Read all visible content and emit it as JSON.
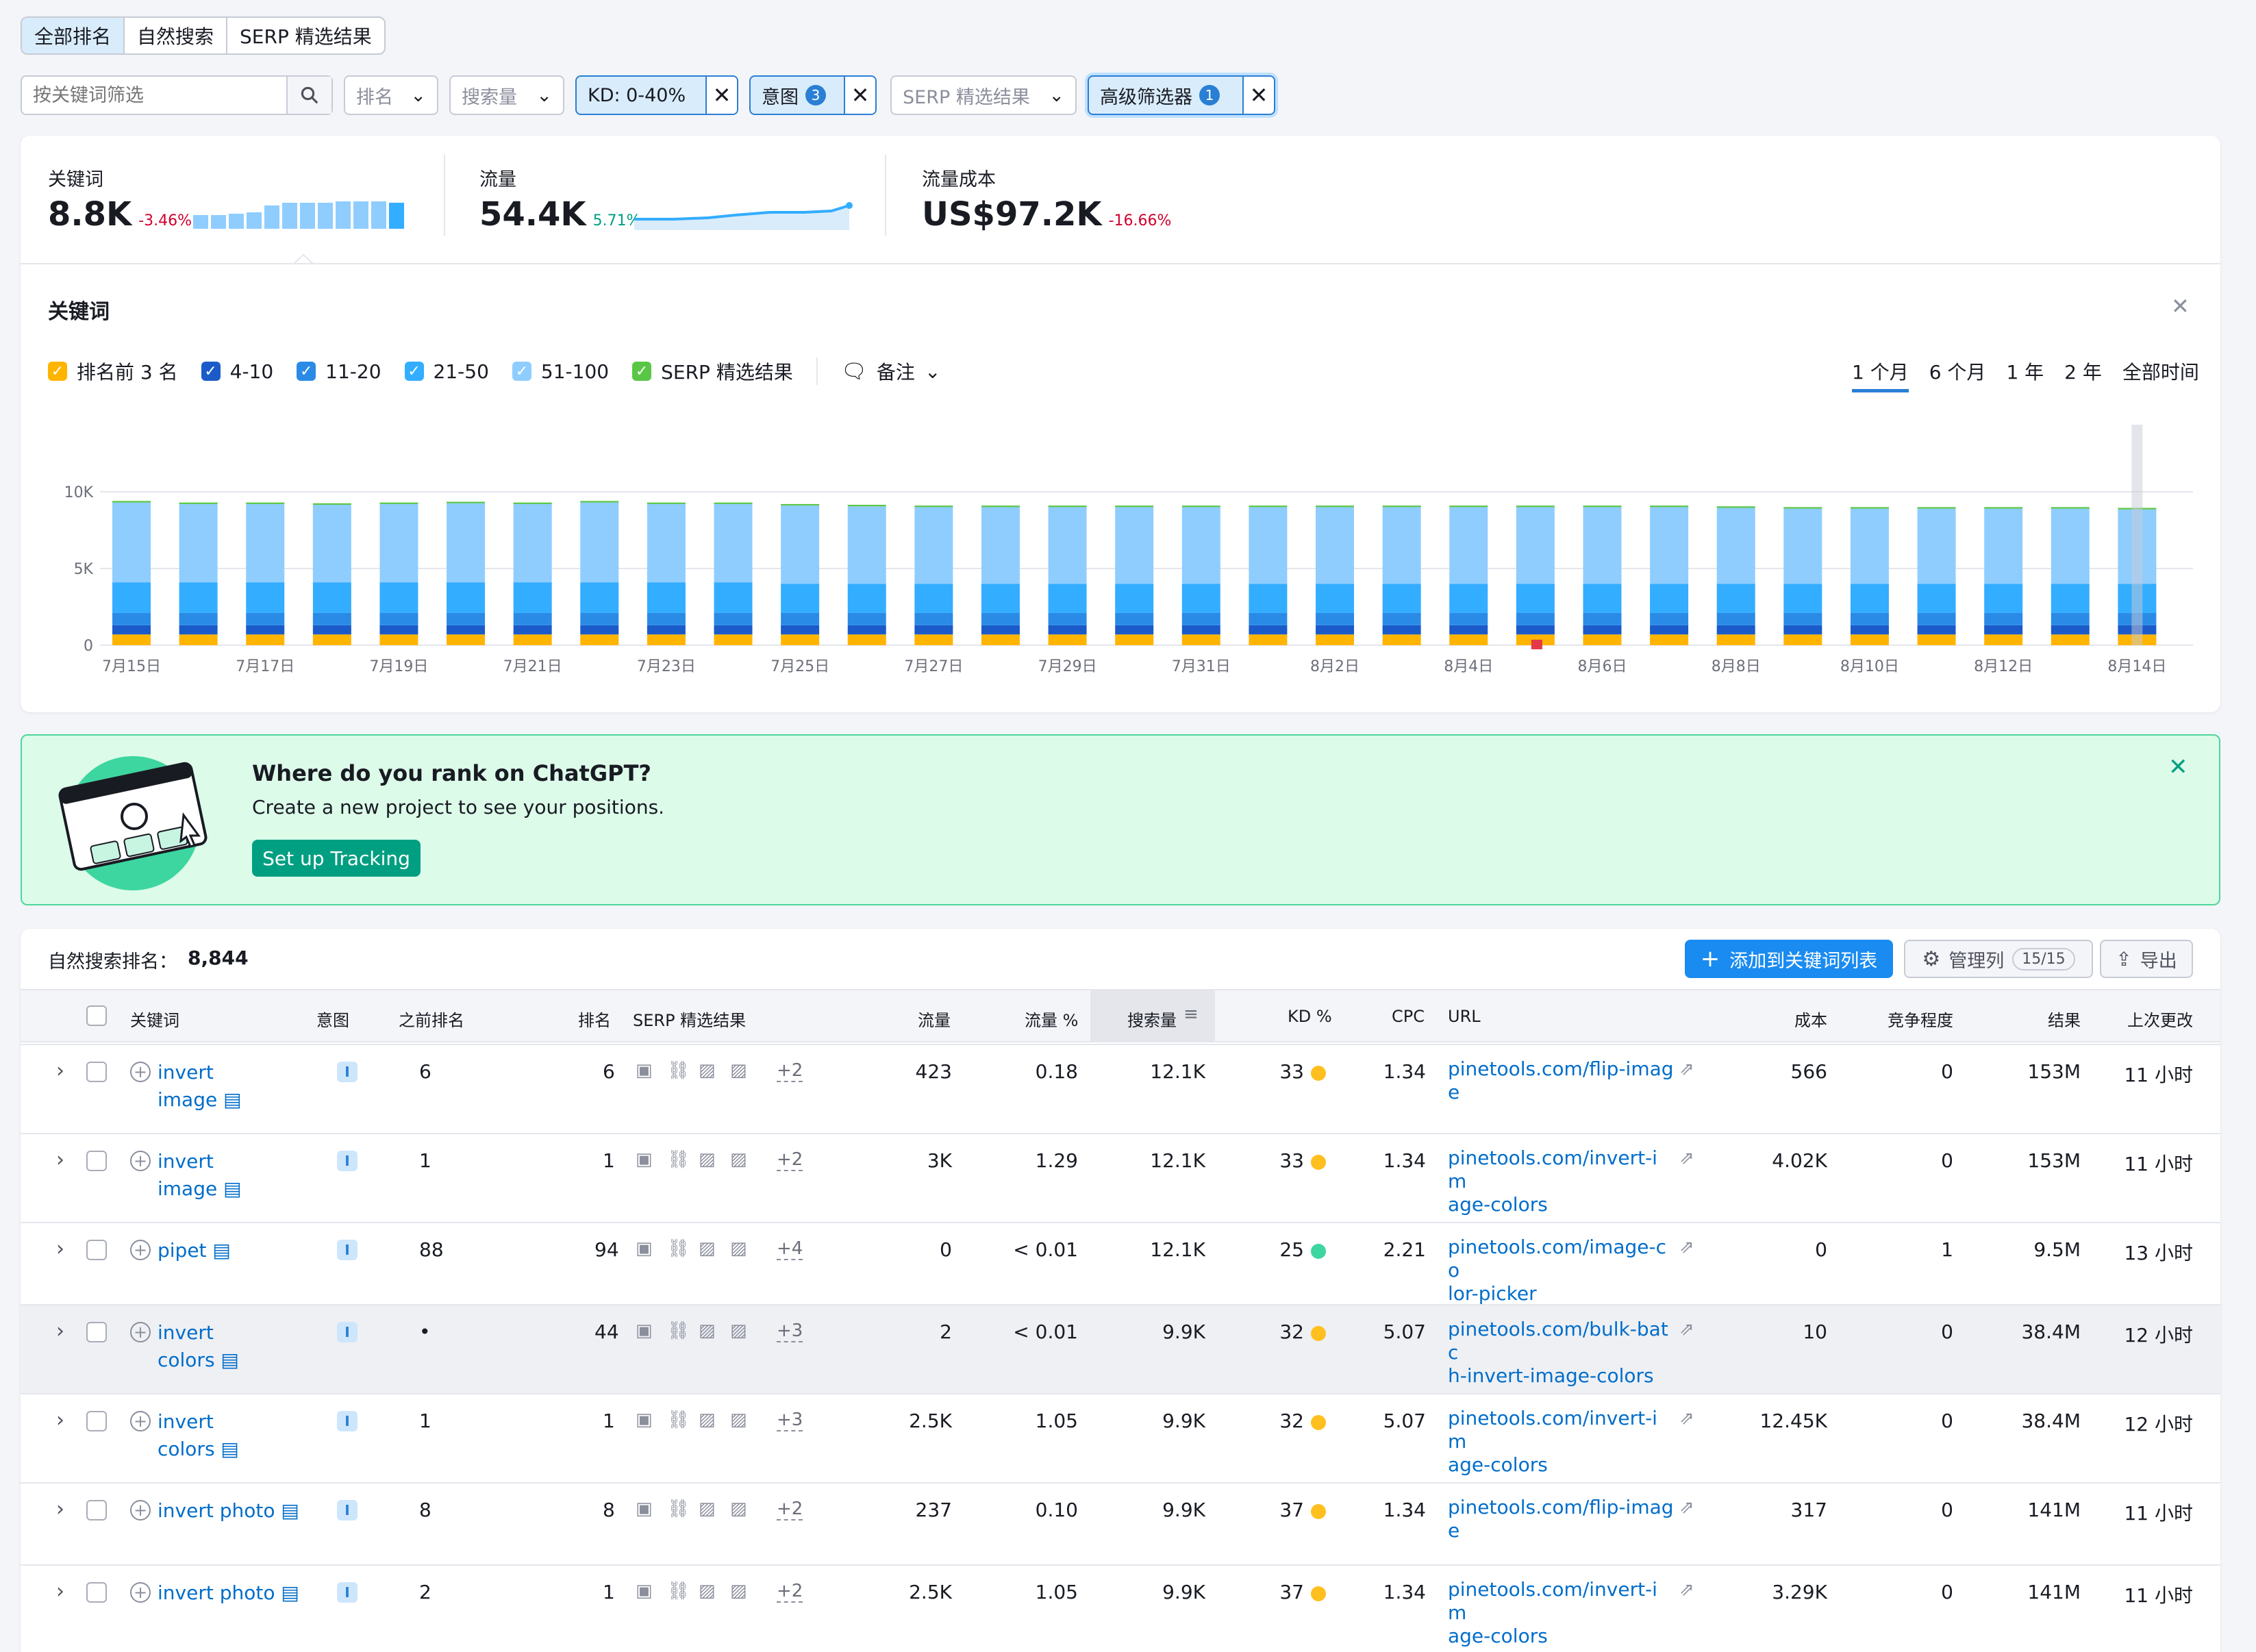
{
  "tabs": [
    "全部排名",
    "自然搜索",
    "SERP 精选结果"
  ],
  "filters": {
    "keyword_placeholder": "按关键词筛选",
    "rank": "排名",
    "volume": "搜索量",
    "kd_chip": "KD: 0-40%",
    "intent_chip": "意图",
    "intent_count": "3",
    "serp": "SERP 精选结果",
    "advanced_chip": "高级筛选器",
    "advanced_count": "1"
  },
  "kpis": [
    {
      "label": "关键词",
      "value": "8.8K",
      "change": "-3.46%"
    },
    {
      "label": "流量",
      "value": "54.4K",
      "change": "5.71%"
    },
    {
      "label": "流量成本",
      "value": "US$97.2K",
      "change": "-16.66%"
    }
  ],
  "chart_panel": {
    "title": "关键词",
    "legend": [
      "排名前 3 名",
      "4-10",
      "11-20",
      "21-50",
      "51-100",
      "SERP 精选结果"
    ],
    "notes": "备注",
    "periods": [
      "1 个月",
      "6 个月",
      "1 年",
      "2 年",
      "全部时间"
    ],
    "active_period": "1 个月"
  },
  "chart_data": {
    "type": "bar",
    "stacked": true,
    "ylim": [
      0,
      10000
    ],
    "yticks": [
      "10K",
      "5K",
      "0"
    ],
    "xticks": [
      "7月15日",
      "7月17日",
      "7月19日",
      "7月21日",
      "7月23日",
      "7月25日",
      "7月27日",
      "7月29日",
      "7月31日",
      "8月2日",
      "8月4日",
      "8月6日",
      "8月8日",
      "8月10日",
      "8月12日",
      "8月14日"
    ],
    "series": [
      {
        "name": "排名前 3 名",
        "color": "#ffb400",
        "values": [
          700,
          700,
          700,
          700,
          700,
          700,
          700,
          700,
          700,
          700,
          700,
          700,
          700,
          700,
          700,
          700,
          700,
          700,
          700,
          700,
          700,
          700,
          700,
          700,
          700,
          700,
          700,
          700,
          700,
          700,
          700
        ]
      },
      {
        "name": "4-10",
        "color": "#1a5bc9",
        "values": [
          600,
          600,
          600,
          600,
          600,
          600,
          600,
          600,
          600,
          600,
          600,
          600,
          600,
          600,
          600,
          600,
          600,
          600,
          600,
          600,
          600,
          600,
          600,
          600,
          600,
          600,
          600,
          600,
          600,
          600,
          600
        ]
      },
      {
        "name": "11-20",
        "color": "#2a8be6",
        "values": [
          800,
          800,
          800,
          800,
          800,
          800,
          800,
          800,
          800,
          800,
          800,
          800,
          800,
          800,
          800,
          800,
          800,
          800,
          800,
          800,
          800,
          800,
          800,
          800,
          800,
          800,
          800,
          800,
          800,
          800,
          800
        ]
      },
      {
        "name": "21-50",
        "color": "#33adff",
        "values": [
          2000,
          2000,
          2000,
          2000,
          2000,
          2000,
          2000,
          2000,
          2000,
          2000,
          1900,
          1900,
          1900,
          1900,
          1900,
          1900,
          1900,
          1900,
          1900,
          1900,
          1900,
          1900,
          1900,
          1900,
          1900,
          1900,
          1900,
          1900,
          1900,
          1900,
          1900
        ]
      },
      {
        "name": "51-100",
        "color": "#8fcdff",
        "values": [
          5200,
          5100,
          5100,
          5050,
          5100,
          5150,
          5100,
          5200,
          5100,
          5100,
          5100,
          5050,
          5000,
          5000,
          5000,
          5000,
          5000,
          5000,
          5000,
          5000,
          5000,
          5000,
          5000,
          5000,
          4950,
          4900,
          4900,
          4900,
          4900,
          4900,
          4850
        ]
      },
      {
        "name": "SERP 精选结果",
        "color": "#59c646",
        "values": [
          100,
          100,
          100,
          100,
          100,
          100,
          100,
          100,
          100,
          100,
          100,
          100,
          100,
          100,
          100,
          100,
          100,
          100,
          100,
          100,
          100,
          100,
          100,
          100,
          100,
          100,
          100,
          100,
          100,
          100,
          100
        ]
      }
    ]
  },
  "banner": {
    "title": "Where do you rank on ChatGPT?",
    "text": "Create a new project to see your positions.",
    "button": "Set up Tracking"
  },
  "table": {
    "count_label": "自然搜索排名：",
    "count": "8,844",
    "add_button": "添加到关键词列表",
    "manage_button": "管理列",
    "manage_count": "15/15",
    "export_button": "导出",
    "columns": [
      "关键词",
      "意图",
      "之前排名",
      "排名",
      "SERP 精选结果",
      "流量",
      "流量 %",
      "搜索量",
      "KD %",
      "CPC",
      "URL",
      "成本",
      "竞争程度",
      "结果",
      "上次更改"
    ],
    "rows": [
      {
        "kw1": "invert",
        "kw2": "image",
        "intent": "I",
        "prev": "6",
        "pos": "6",
        "more": "+2",
        "traffic": "423",
        "tpct": "0.18",
        "vol": "12.1K",
        "kd": "33",
        "kdc": "#ffbf1f",
        "cpc": "1.34",
        "url1": "pinetools.com/flip-imag",
        "url2": "e",
        "cost": "566",
        "comp": "0",
        "res": "153M",
        "upd": "11 小时"
      },
      {
        "kw1": "invert",
        "kw2": "image",
        "intent": "I",
        "prev": "1",
        "pos": "1",
        "more": "+2",
        "traffic": "3K",
        "tpct": "1.29",
        "vol": "12.1K",
        "kd": "33",
        "kdc": "#ffbf1f",
        "cpc": "1.34",
        "url1": "pinetools.com/invert-im",
        "url2": "age-colors",
        "cost": "4.02K",
        "comp": "0",
        "res": "153M",
        "upd": "11 小时"
      },
      {
        "kw1": "pipet",
        "kw2": "",
        "intent": "I",
        "prev": "88",
        "pos": "94",
        "more": "+4",
        "traffic": "0",
        "tpct": "< 0.01",
        "vol": "12.1K",
        "kd": "25",
        "kdc": "#3dd6a0",
        "cpc": "2.21",
        "url1": "pinetools.com/image-co",
        "url2": "lor-picker",
        "cost": "0",
        "comp": "1",
        "res": "9.5M",
        "upd": "13 小时"
      },
      {
        "kw1": "invert",
        "kw2": "colors",
        "intent": "I",
        "prev": "•",
        "pos": "44",
        "more": "+3",
        "traffic": "2",
        "tpct": "< 0.01",
        "vol": "9.9K",
        "kd": "32",
        "kdc": "#ffbf1f",
        "cpc": "5.07",
        "url1": "pinetools.com/bulk-batc",
        "url2": "h-invert-image-colors",
        "cost": "10",
        "comp": "0",
        "res": "38.4M",
        "upd": "12 小时"
      },
      {
        "kw1": "invert",
        "kw2": "colors",
        "intent": "I",
        "prev": "1",
        "pos": "1",
        "more": "+3",
        "traffic": "2.5K",
        "tpct": "1.05",
        "vol": "9.9K",
        "kd": "32",
        "kdc": "#ffbf1f",
        "cpc": "5.07",
        "url1": "pinetools.com/invert-im",
        "url2": "age-colors",
        "cost": "12.45K",
        "comp": "0",
        "res": "38.4M",
        "upd": "12 小时"
      },
      {
        "kw1": "invert photo",
        "kw2": "",
        "intent": "I",
        "prev": "8",
        "pos": "8",
        "more": "+2",
        "traffic": "237",
        "tpct": "0.10",
        "vol": "9.9K",
        "kd": "37",
        "kdc": "#ffbf1f",
        "cpc": "1.34",
        "url1": "pinetools.com/flip-imag",
        "url2": "e",
        "cost": "317",
        "comp": "0",
        "res": "141M",
        "upd": "11 小时"
      },
      {
        "kw1": "invert photo",
        "kw2": "",
        "intent": "I",
        "prev": "2",
        "pos": "1",
        "more": "+2",
        "traffic": "2.5K",
        "tpct": "1.05",
        "vol": "9.9K",
        "kd": "37",
        "kdc": "#ffbf1f",
        "cpc": "1.34",
        "url1": "pinetools.com/invert-im",
        "url2": "age-colors",
        "cost": "3.29K",
        "comp": "0",
        "res": "141M",
        "upd": "11 小时"
      }
    ]
  }
}
